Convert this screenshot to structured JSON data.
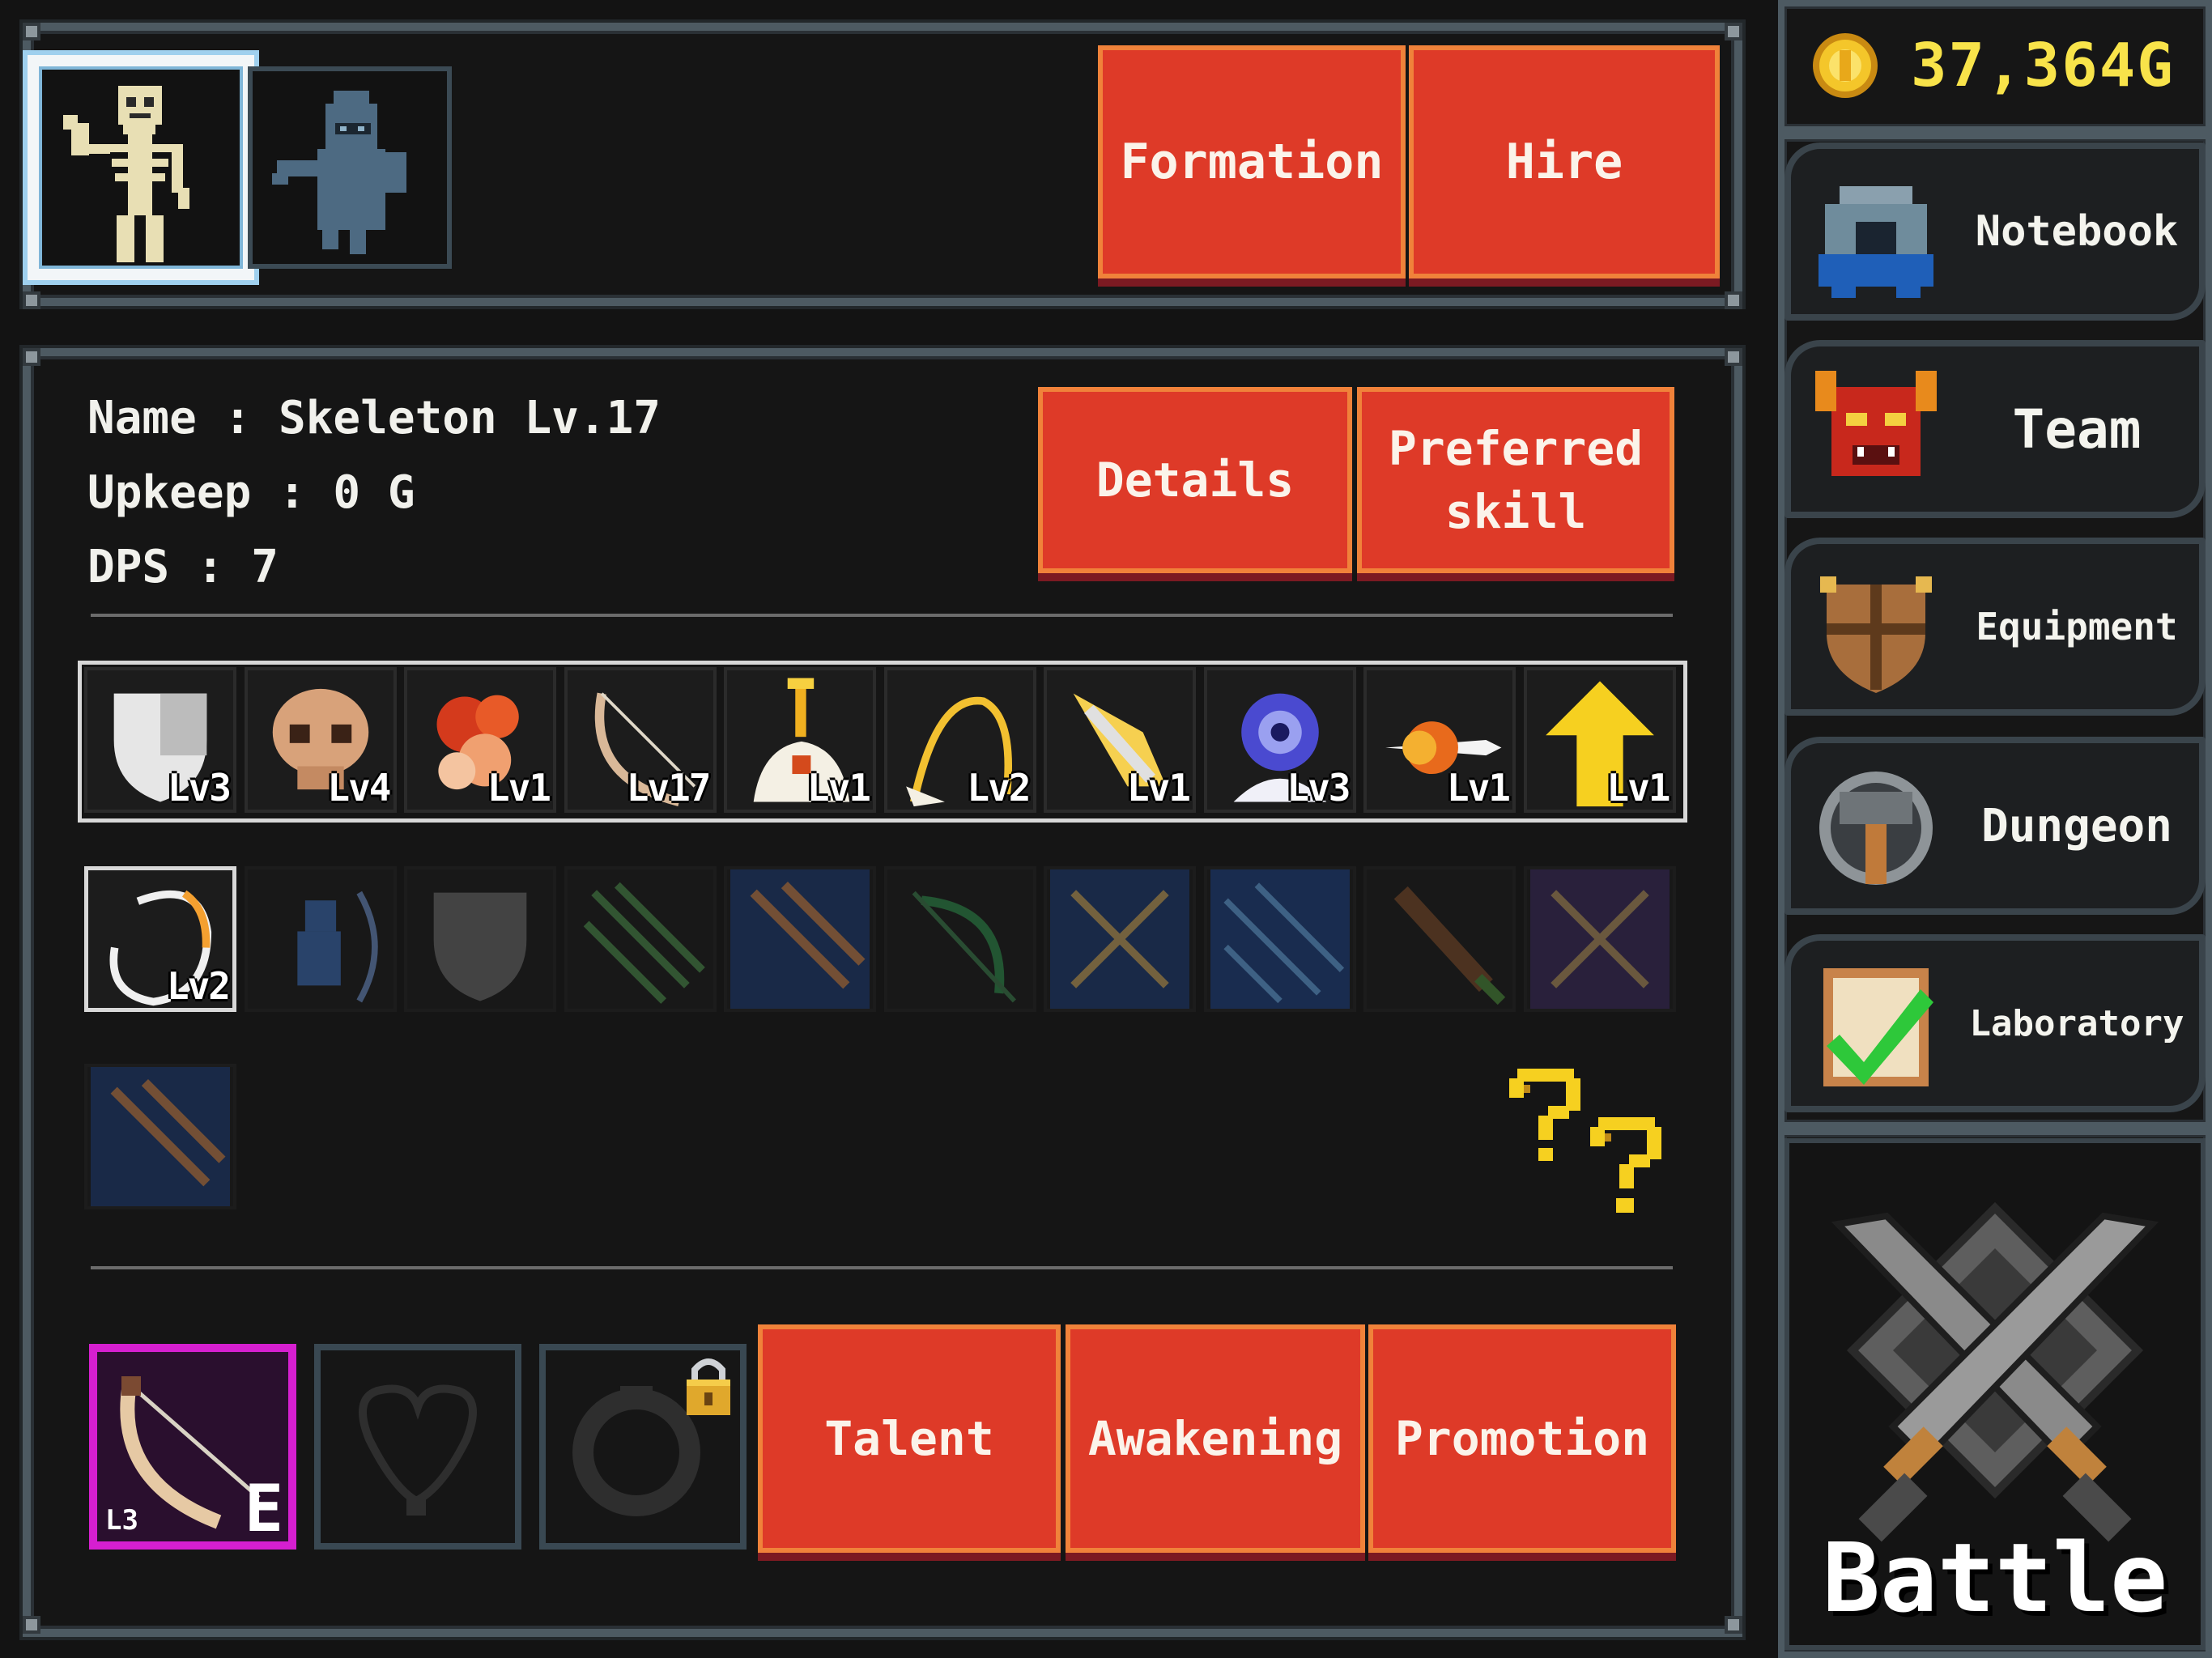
{
  "roster": {
    "units": [
      {
        "name": "skeleton-portrait",
        "selected": true
      },
      {
        "name": "hooded-ghost-portrait",
        "selected": false
      }
    ],
    "formation_label": "Formation",
    "hire_label": "Hire"
  },
  "info": {
    "name_line": "Name : Skeleton Lv.17",
    "upkeep_line": "Upkeep : 0 G",
    "dps_line": "DPS : 7",
    "details_label": "Details",
    "preferred_label": "Preferred skill"
  },
  "skills_active": [
    {
      "icon": "shield-icon",
      "level": "Lv3"
    },
    {
      "icon": "skull-icon",
      "level": "Lv4"
    },
    {
      "icon": "flame-burst-icon",
      "level": "Lv1"
    },
    {
      "icon": "bow-icon",
      "level": "Lv17"
    },
    {
      "icon": "gold-pedestal-icon",
      "level": "Lv1"
    },
    {
      "icon": "golden-whip-icon",
      "level": "Lv2"
    },
    {
      "icon": "golden-feather-icon",
      "level": "Lv1"
    },
    {
      "icon": "blue-eye-orb-icon",
      "level": "Lv3"
    },
    {
      "icon": "fire-arrow-icon",
      "level": "Lv1"
    },
    {
      "icon": "yellow-up-arrow-icon",
      "level": "Lv1"
    }
  ],
  "skills_passive": [
    {
      "icon": "ring-swirl-icon",
      "level": "Lv2",
      "unlocked": true
    },
    {
      "icon": "archer-icon",
      "unlocked": false
    },
    {
      "icon": "dark-shield-icon",
      "unlocked": false
    },
    {
      "icon": "green-arrows-icon",
      "unlocked": false
    },
    {
      "icon": "blue-arrows-icon",
      "unlocked": false
    },
    {
      "icon": "green-bow-icon",
      "unlocked": false
    },
    {
      "icon": "crossed-bows-icon",
      "unlocked": false
    },
    {
      "icon": "blue-rain-arrows-icon",
      "unlocked": false
    },
    {
      "icon": "brown-club-icon",
      "unlocked": false
    },
    {
      "icon": "purple-crossed-bows-icon",
      "unlocked": false
    }
  ],
  "skills_extra": [
    {
      "icon": "blue-arrows-icon",
      "unlocked": false
    }
  ],
  "help_icon": "question-marks-icon",
  "equipment": {
    "weapon": {
      "level": "L3",
      "tag": "E"
    },
    "talent_label": "Talent",
    "awakening_label": "Awakening",
    "promotion_label": "Promotion"
  },
  "sidebar": {
    "gold": "37,364G",
    "notebook_label": "Notebook",
    "team_label": "Team",
    "equipment_label": "Equipment",
    "dungeon_label": "Dungeon",
    "laboratory_label": "Laboratory",
    "battle_label": "Battle"
  },
  "colors": {
    "button_red": "#de3a28",
    "button_border": "#f0823a",
    "gold_text": "#f8e34a",
    "frame": "#4d5a62",
    "weapon_border": "#d61fd0"
  }
}
